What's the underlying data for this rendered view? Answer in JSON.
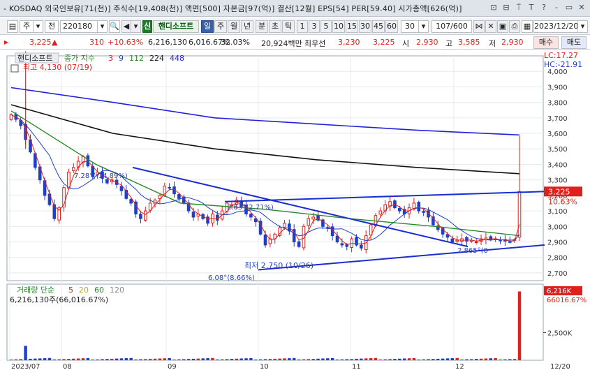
{
  "window": {
    "title": "- KOSDAQ 외국인보유[71(천)] 주식수[19,408(천)] 액면[500] 자본금[97(억)] 결산[12월] EPS[54] PER[59.40] 시가총액[626(억)]"
  },
  "toolbar": {
    "type_label": "주",
    "all_label": "전",
    "code_value": "220180",
    "shin_label": "신",
    "stock_name": "핸디소프트",
    "periods": [
      "일",
      "주",
      "월",
      "년",
      "분",
      "초",
      "틱"
    ],
    "selected_period": "일",
    "intervals": [
      "1",
      "3",
      "5",
      "10",
      "15",
      "30",
      "45",
      "60"
    ],
    "interval_value": "30",
    "count_value": "107/600",
    "date_value": "2023/12/20",
    "buy_label": "매수",
    "sell_label": "매도"
  },
  "quote": {
    "price": "3,225",
    "change": "310",
    "change_pct": "+10.63%",
    "volume": "6,216,130",
    "volume_pct": "6,016.67%",
    "turnover": "32.03%",
    "amount": "20,924백만",
    "pref_label": "최우선",
    "ask": "3,230",
    "bid": "3,225",
    "open_label": "시",
    "open": "2,930",
    "high_label": "고",
    "high": "3,585",
    "low_label": "저",
    "low": "2,930"
  },
  "chart": {
    "price_legend_name": "핸디소프트",
    "ma_label": "종가 지수",
    "ma_periods": [
      "3",
      "9",
      "112",
      "224",
      "448"
    ],
    "max_annotation": "최고 4,130 (07/19)",
    "min_annotation": "최저 2,750 (10/26)",
    "trend_labels": [
      "7.28°(-14.89%)",
      "2.63°(2.71%)",
      "6.08°(8.66%)",
      "2.865°(0"
    ],
    "lc": "LC:17.27",
    "hc": "HC:-21.91",
    "current_price_tag": "3,225",
    "current_pct_tag": "10.63%",
    "y_ticks": [
      "4,000",
      "3,900",
      "3,800",
      "3,700",
      "3,600",
      "3,500",
      "3,400",
      "3,300",
      "3,200",
      "3,100",
      "3,000",
      "2,900",
      "2,800",
      "2,700"
    ],
    "volume_legend": "거래량 단순",
    "vol_ma_periods": [
      "5",
      "20",
      "60",
      "120"
    ],
    "volume_value_text": "6,216,130주(66,016.67%)",
    "volume_tag_1": "6,216K",
    "volume_tag_2": "66016.67%",
    "volume_y_tick": "2,500K",
    "x_labels": [
      "2023/07",
      "08",
      "09",
      "10",
      "11",
      "12"
    ],
    "x_right_label": "12/20"
  },
  "colors": {
    "up": "#e0201c",
    "down": "#1e3fc8",
    "ma3": "#e0201c",
    "ma9": "#1e3fc8",
    "ma112": "#2a8a2a",
    "ma224": "#111111",
    "ma448": "#2222dd"
  },
  "chart_data": {
    "type": "candlestick",
    "closes": [
      3720,
      3690,
      3650,
      3560,
      3480,
      3380,
      3300,
      3200,
      3140,
      3050,
      3120,
      3250,
      3350,
      3380,
      3420,
      3450,
      3390,
      3320,
      3350,
      3310,
      3280,
      3300,
      3270,
      3230,
      3180,
      3150,
      3080,
      3050,
      3100,
      3150,
      3170,
      3200,
      3260,
      3250,
      3210,
      3180,
      3150,
      3100,
      3060,
      3080,
      3050,
      3020,
      3080,
      3040,
      3100,
      3150,
      3140,
      3170,
      3130,
      3080,
      3060,
      3030,
      2950,
      2880,
      2920,
      2950,
      2990,
      3020,
      2970,
      2900,
      2870,
      3000,
      3050,
      3060,
      3040,
      3000,
      2990,
      2940,
      2900,
      2880,
      2870,
      2920,
      2880,
      2860,
      2940,
      3010,
      3070,
      3100,
      3140,
      3160,
      3120,
      3100,
      3080,
      3120,
      3150,
      3100,
      3090,
      3060,
      3010,
      2980,
      2950,
      2930,
      2900,
      2910,
      2920,
      2905,
      2910,
      2900,
      2920,
      2925,
      2915,
      2920,
      2910,
      2905,
      2900,
      2915,
      3225
    ],
    "ma_legend_periods": [
      3,
      9,
      112,
      224,
      448
    ],
    "ma112": [
      3745,
      3400,
      3150,
      3110,
      3050,
      3000,
      2940
    ],
    "ma224": [
      3785,
      3600,
      3500,
      3430,
      3380,
      3340
    ],
    "ma448": [
      3895,
      3800,
      3700,
      3660,
      3620,
      3590
    ],
    "max": {
      "value": 4130,
      "date": "07/19"
    },
    "min": {
      "value": 2750,
      "date": "10/26"
    },
    "ylim": [
      2650,
      4100
    ],
    "last_volume": 6216130,
    "volume_ylim": [
      0,
      6500000
    ]
  }
}
